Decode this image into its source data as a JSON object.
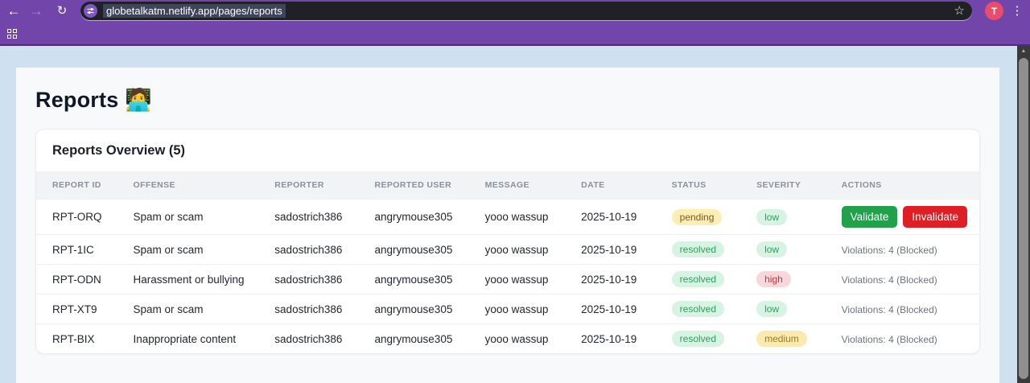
{
  "browser": {
    "url": "globetalkatm.netlify.app/pages/reports",
    "avatar_letter": "T"
  },
  "page": {
    "title": "Reports",
    "title_emoji": "🧑‍💻",
    "card_title": "Reports Overview (5)"
  },
  "table": {
    "columns": [
      "Report ID",
      "Offense",
      "Reporter",
      "Reported User",
      "Message",
      "Date",
      "Status",
      "Severity",
      "Actions"
    ],
    "rows": [
      {
        "id": "RPT-ORQ",
        "offense": "Spam or scam",
        "reporter": "sadostrich386",
        "reported_user": "angrymouse305",
        "message": "yooo wassup",
        "date": "2025-10-19",
        "status": "pending",
        "severity": "low",
        "actions": {
          "type": "buttons",
          "validate_label": "Validate",
          "invalidate_label": "Invalidate"
        }
      },
      {
        "id": "RPT-1IC",
        "offense": "Spam or scam",
        "reporter": "sadostrich386",
        "reported_user": "angrymouse305",
        "message": "yooo wassup",
        "date": "2025-10-19",
        "status": "resolved",
        "severity": "low",
        "actions": {
          "type": "text",
          "label": "Violations: 4 (Blocked)"
        }
      },
      {
        "id": "RPT-ODN",
        "offense": "Harassment or bullying",
        "reporter": "sadostrich386",
        "reported_user": "angrymouse305",
        "message": "yooo wassup",
        "date": "2025-10-19",
        "status": "resolved",
        "severity": "high",
        "actions": {
          "type": "text",
          "label": "Violations: 4 (Blocked)"
        }
      },
      {
        "id": "RPT-XT9",
        "offense": "Spam or scam",
        "reporter": "sadostrich386",
        "reported_user": "angrymouse305",
        "message": "yooo wassup",
        "date": "2025-10-19",
        "status": "resolved",
        "severity": "low",
        "actions": {
          "type": "text",
          "label": "Violations: 4 (Blocked)"
        }
      },
      {
        "id": "RPT-BIX",
        "offense": "Inappropriate content",
        "reporter": "sadostrich386",
        "reported_user": "angrymouse305",
        "message": "yooo wassup",
        "date": "2025-10-19",
        "status": "resolved",
        "severity": "medium",
        "actions": {
          "type": "text",
          "label": "Violations: 4 (Blocked)"
        }
      }
    ]
  },
  "icons": {
    "back": "←",
    "forward": "→",
    "reload": "↻",
    "star": "☆",
    "menu": "⋮",
    "scroll_up": "▲"
  },
  "colors": {
    "chrome_purple": "#7245ab",
    "chrome_border": "#4c2b7c",
    "omnibox_dark": "#1f2124",
    "url_selection": "#3e4459",
    "avatar_pink": "#ea4c6c",
    "page_background": "#cfe0f1",
    "container_background": "#f8f9fa",
    "card_background": "#ffffff",
    "table_header_bg": "#f1f3f5",
    "validate_green": "#21a24a",
    "invalidate_red": "#e01f24",
    "status_pending_bg": "#fceeb5",
    "status_pending_text": "#7d5a1a",
    "status_resolved_bg": "#d7f3e3",
    "status_resolved_text": "#2f9e60",
    "severity_high_bg": "#f8d7da",
    "severity_high_text": "#d2323f",
    "severity_medium_bg": "#fbeab0",
    "severity_medium_text": "#9c7a1c"
  }
}
